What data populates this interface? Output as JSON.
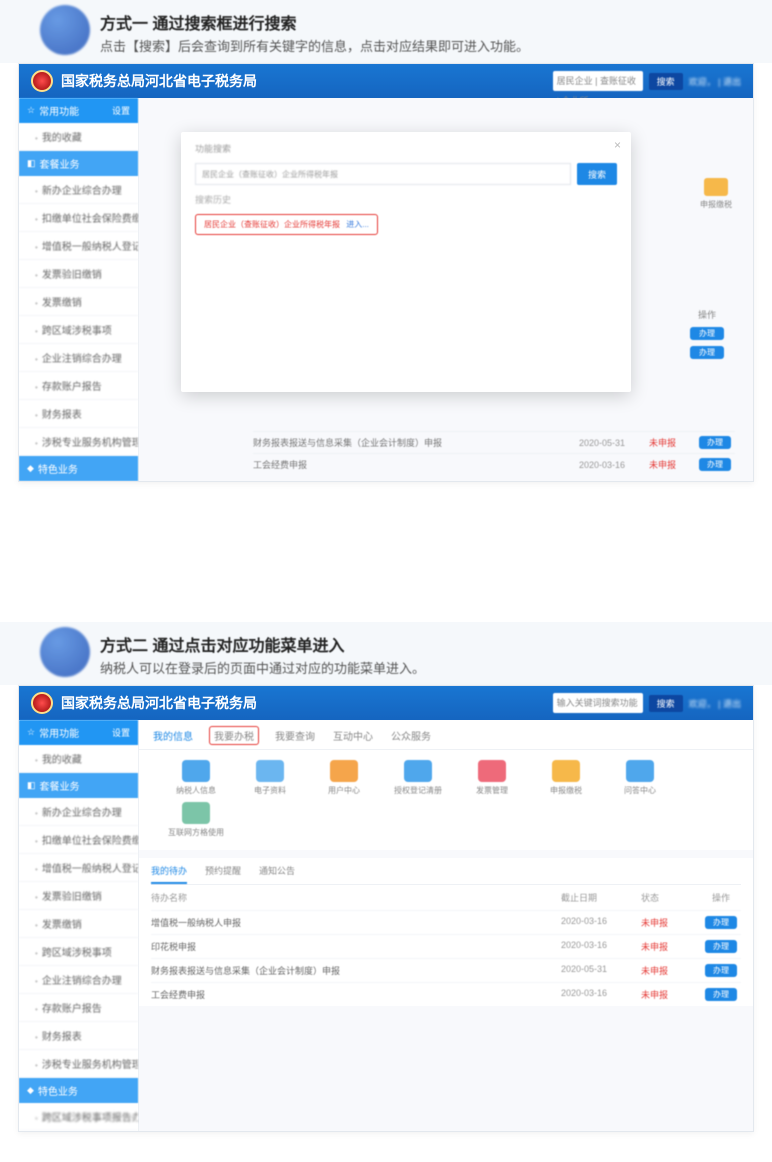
{
  "section1": {
    "title": "方式一 通过搜索框进行搜索",
    "subtitle": "点击【搜索】后会查询到所有关键字的信息，点击对应结果即可进入功能。"
  },
  "section2": {
    "title": "方式二 通过点击对应功能菜单进入",
    "subtitle": "纳税人可以在登录后的页面中通过对应的功能菜单进入。"
  },
  "app": {
    "title": "国家税务总局河北省电子税务局",
    "top_search_placeholder": "居民企业 | 查账征收 | 企业所...",
    "search_placeholder2": "输入关键词搜索功能",
    "search_btn": "搜索",
    "user_area": "欢迎，                      | 退出"
  },
  "sidebar": {
    "heading1": "常用功能",
    "heading1_badge": "设置",
    "item_fav": "我的收藏",
    "heading2": "套餐业务",
    "items": [
      "新办企业综合办理",
      "扣缴单位社会保险费缴",
      "增值税一般纳税人登记",
      "发票验旧缴销",
      "发票缴销",
      "跨区域涉税事项",
      "企业注销综合办理",
      "存款账户报告",
      "财务报表",
      "涉税专业服务机构管理表"
    ],
    "heading3": "特色业务"
  },
  "right_icon": {
    "label": "申报缴税"
  },
  "right_col": {
    "header": "操作",
    "btn": "办理"
  },
  "modal": {
    "title": "功能搜索",
    "input": "居民企业（查账征收）企业所得税年报",
    "btn": "搜索",
    "history_label": "搜索历史",
    "result": "居民企业（查账征收）企业所得税年报",
    "more": "进入..."
  },
  "bottom_rows": [
    {
      "name": "财务报表报送与信息采集（企业会计制度）申报",
      "date": "2020-05-31",
      "status": "未申报",
      "btn": "办理"
    },
    {
      "name": "工会经费申报",
      "date": "2020-03-16",
      "status": "未申报",
      "btn": "办理"
    }
  ],
  "s2": {
    "tabs": [
      "我的信息",
      "我要办税",
      "我要查询",
      "互动中心",
      "公众服务"
    ],
    "icons": [
      {
        "label": "纳税人信息",
        "color": "#4fa7ec"
      },
      {
        "label": "电子资料",
        "color": "#6bb6f0"
      },
      {
        "label": "用户中心",
        "color": "#f5a54b"
      },
      {
        "label": "授权登记清册",
        "color": "#4fa7ec"
      },
      {
        "label": "发票管理",
        "color": "#ee6a7a"
      },
      {
        "label": "申报缴税",
        "color": "#f6b84a"
      },
      {
        "label": "问答中心",
        "color": "#4fa7ec"
      },
      {
        "label": "互联网方格使用",
        "color": "#7cc5a8"
      }
    ],
    "table_tabs": [
      "我的待办",
      "预约提醒",
      "通知公告"
    ],
    "head": {
      "c1": "待办名称",
      "c2": "截止日期",
      "c3": "状态",
      "c4": "操作"
    },
    "rows": [
      {
        "name": "增值税一般纳税人申报",
        "date": "2020-03-16",
        "status": "未申报",
        "btn": "办理"
      },
      {
        "name": "印花税申报",
        "date": "2020-03-16",
        "status": "未申报",
        "btn": "办理"
      },
      {
        "name": "财务报表报送与信息采集（企业会计制度）申报",
        "date": "2020-05-31",
        "status": "未申报",
        "btn": "办理"
      },
      {
        "name": "工会经费申报",
        "date": "2020-03-16",
        "status": "未申报",
        "btn": "办理"
      }
    ]
  }
}
